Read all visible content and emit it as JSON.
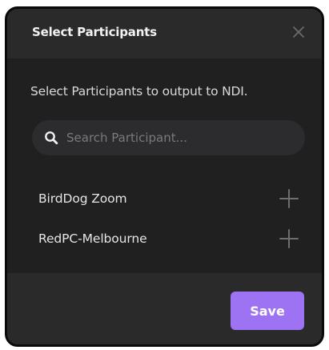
{
  "dialog": {
    "title": "Select Participants",
    "subtitle": "Select Participants to output to NDI.",
    "close_icon": "close-icon"
  },
  "search": {
    "placeholder": "Search Participant...",
    "value": "",
    "icon": "search-icon"
  },
  "participants": [
    {
      "name": "BirdDog Zoom",
      "action_icon": "plus-icon"
    },
    {
      "name": "RedPC-Melbourne",
      "action_icon": "plus-icon"
    }
  ],
  "footer": {
    "save_label": "Save"
  },
  "colors": {
    "dialog_bg": "#202021",
    "header_bg": "#2a2a2b",
    "accent": "#9d73f3",
    "text": "#e6e6e8",
    "muted": "#7a7a7e"
  }
}
